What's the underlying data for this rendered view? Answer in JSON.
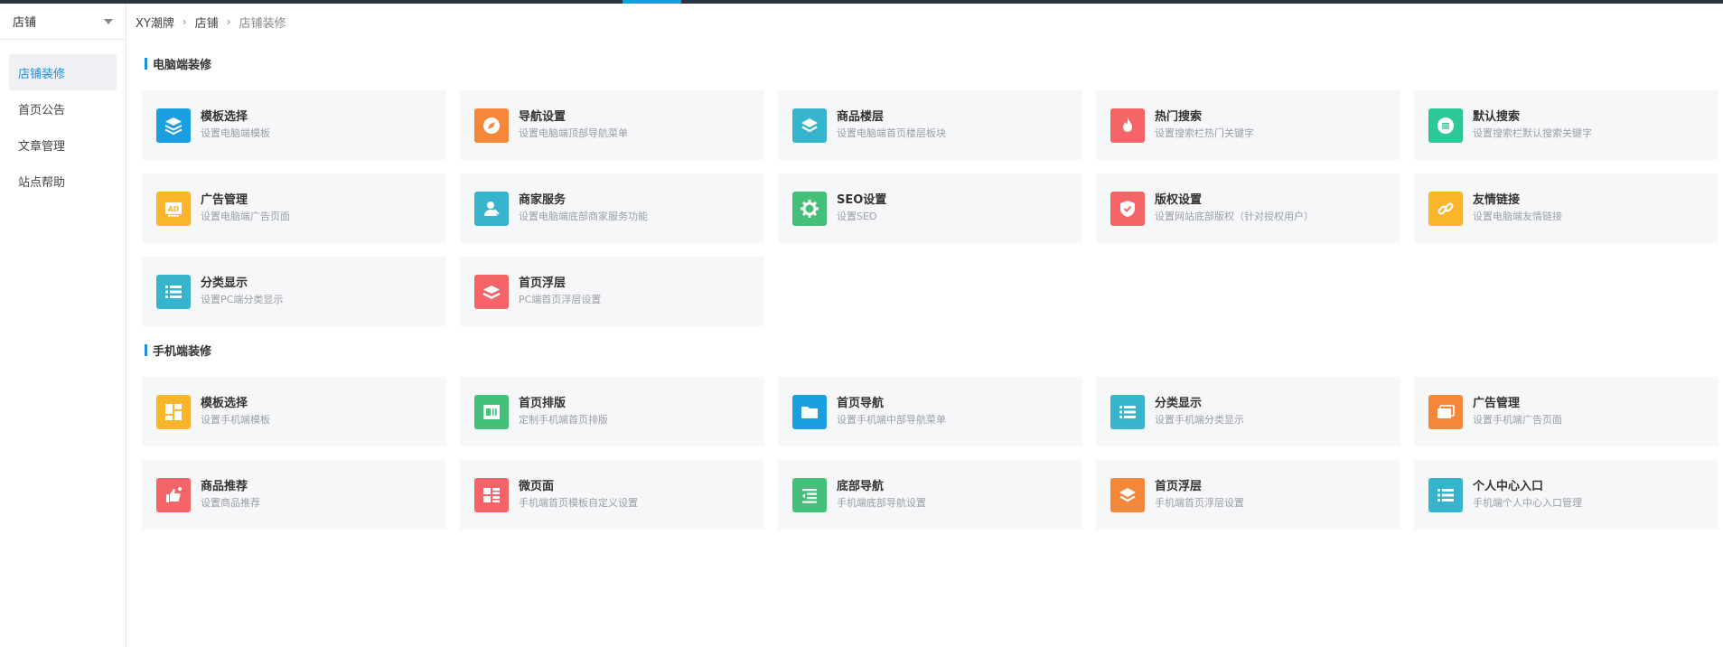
{
  "breadcrumb": {
    "root": "XY潮牌",
    "level1": "店铺",
    "current": "店铺装修"
  },
  "sidebar": {
    "header": "店铺",
    "items": [
      {
        "label": "店铺装修"
      },
      {
        "label": "首页公告"
      },
      {
        "label": "文章管理"
      },
      {
        "label": "站点帮助"
      }
    ]
  },
  "pc": {
    "section_title": "电脑端装修",
    "cards": [
      {
        "title": "模板选择",
        "desc": "设置电脑端模板",
        "icon": "layers-icon",
        "color": "#1a9ee0"
      },
      {
        "title": "导航设置",
        "desc": "设置电脑端顶部导航菜单",
        "icon": "compass-icon",
        "color": "#f5873b"
      },
      {
        "title": "商品楼层",
        "desc": "设置电脑端首页楼层板块",
        "icon": "stack-icon",
        "color": "#35b4cb"
      },
      {
        "title": "热门搜索",
        "desc": "设置搜索栏热门关键字",
        "icon": "flame-icon",
        "color": "#f56467"
      },
      {
        "title": "默认搜索",
        "desc": "设置搜索栏默认搜索关键字",
        "icon": "search-list-icon",
        "color": "#2ec798"
      },
      {
        "title": "广告管理",
        "desc": "设置电脑端广告页面",
        "icon": "ad-icon",
        "color": "#fbb52d"
      },
      {
        "title": "商家服务",
        "desc": "设置电脑端底部商家服务功能",
        "icon": "service-person-icon",
        "color": "#35b4cb"
      },
      {
        "title": "SEO设置",
        "desc": "设置SEO",
        "icon": "gear-icon",
        "color": "#45c07a"
      },
      {
        "title": "版权设置",
        "desc": "设置网站底部版权（针对授权用户）",
        "icon": "shield-icon",
        "color": "#f56467"
      },
      {
        "title": "友情链接",
        "desc": "设置电脑端友情链接",
        "icon": "link-icon",
        "color": "#fbb52d"
      },
      {
        "title": "分类显示",
        "desc": "设置PC端分类显示",
        "icon": "list-icon",
        "color": "#35b4cb"
      },
      {
        "title": "首页浮层",
        "desc": "PC端首页浮层设置",
        "icon": "float-layer-icon",
        "color": "#f56467"
      }
    ]
  },
  "mobile": {
    "section_title": "手机端装修",
    "cards": [
      {
        "title": "模板选择",
        "desc": "设置手机端模板",
        "icon": "template-grid-icon",
        "color": "#fbb52d"
      },
      {
        "title": "首页排版",
        "desc": "定制手机端首页排版",
        "icon": "layout-card-icon",
        "color": "#45c07a"
      },
      {
        "title": "首页导航",
        "desc": "设置手机端中部导航菜单",
        "icon": "folder-icon",
        "color": "#1a9ee0"
      },
      {
        "title": "分类显示",
        "desc": "设置手机端分类显示",
        "icon": "list-icon",
        "color": "#35b4cb"
      },
      {
        "title": "广告管理",
        "desc": "设置手机端广告页面",
        "icon": "ad-cards-icon",
        "color": "#f5873b"
      },
      {
        "title": "商品推荐",
        "desc": "设置商品推荐",
        "icon": "thumbs-up-icon",
        "color": "#f56467"
      },
      {
        "title": "微页面",
        "desc": "手机端首页模板自定义设置",
        "icon": "micro-page-icon",
        "color": "#f56467"
      },
      {
        "title": "底部导航",
        "desc": "手机端底部导航设置",
        "icon": "bottom-nav-icon",
        "color": "#45c07a"
      },
      {
        "title": "首页浮层",
        "desc": "手机端首页浮层设置",
        "icon": "stack-icon",
        "color": "#f5873b"
      },
      {
        "title": "个人中心入口",
        "desc": "手机端个人中心入口管理",
        "icon": "list-icon",
        "color": "#35b4cb"
      }
    ]
  }
}
